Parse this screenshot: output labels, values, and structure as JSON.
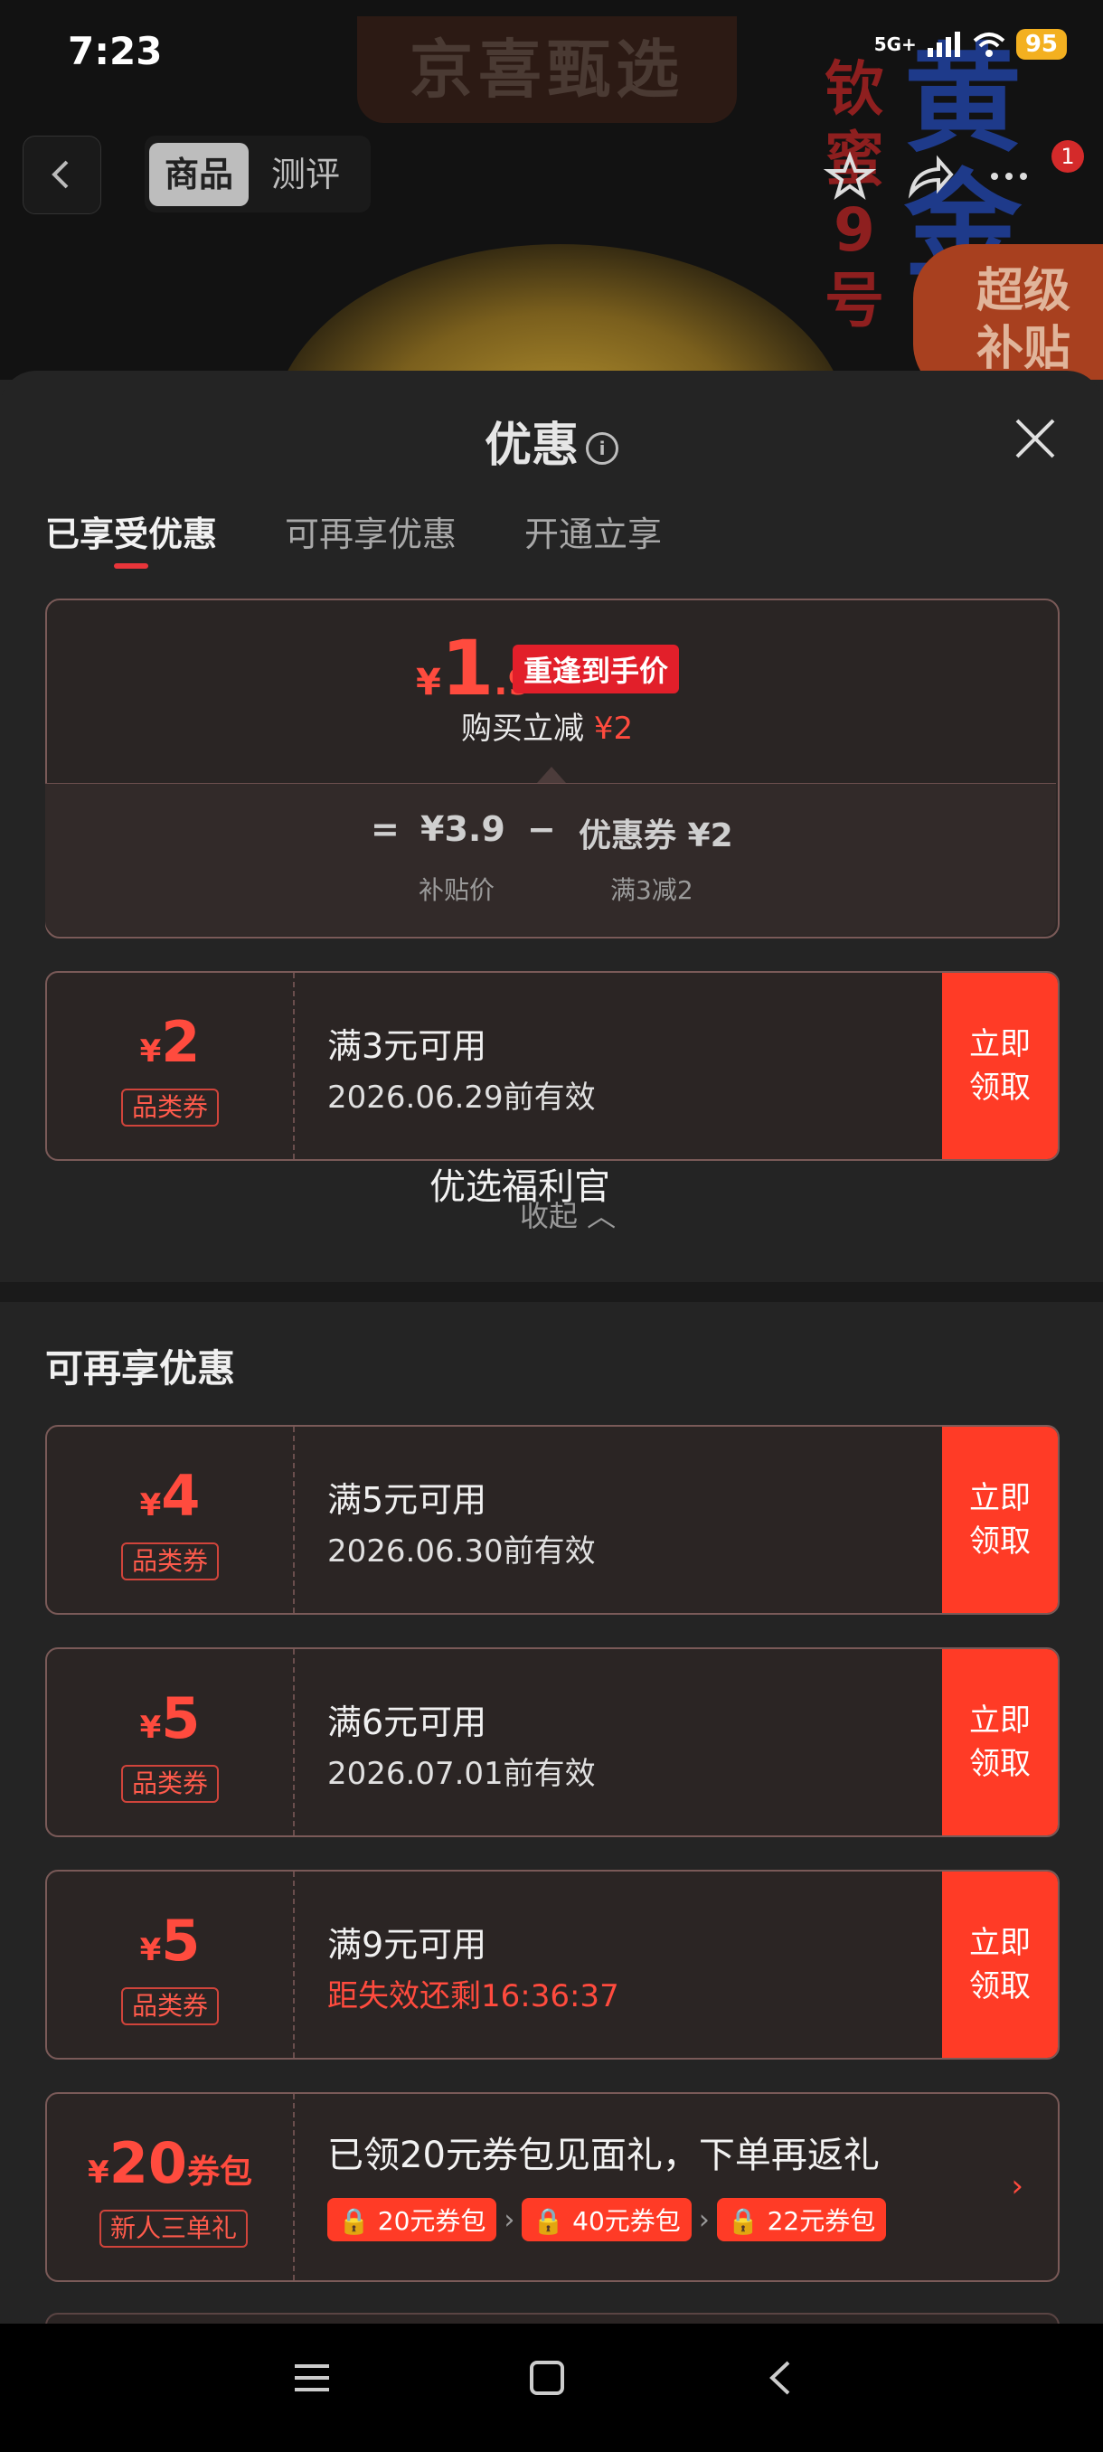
{
  "status_bar": {
    "time": "7:23",
    "network": "5G+",
    "battery": "95"
  },
  "background": {
    "brand": "京喜甄选",
    "red_text": "钦蜜9号",
    "blue_text": "黄金",
    "subsidy_badge": "超级补贴"
  },
  "header": {
    "tab_product": "商品",
    "tab_review": "测评",
    "badge_count": "1"
  },
  "sheet": {
    "title": "优惠",
    "info_glyph": "i",
    "tabs": [
      "已享受优惠",
      "可再享优惠",
      "开通立享"
    ],
    "summary": {
      "currency": "¥",
      "price_big": "1",
      "price_small": ".9",
      "price_tag": "重逢到手价",
      "buy_label": "购买立减",
      "buy_amount": "¥2",
      "eq": "=",
      "subsidy_price": "¥3.9",
      "minus": "−",
      "coupon_text": "优惠券 ¥2",
      "subsidy_label": "补贴价",
      "coupon_label": "满3减2"
    },
    "coupon_enjoyed": {
      "currency": "¥",
      "amount": "2",
      "category": "品类券",
      "condition": "满3元可用",
      "expiry": "2026.06.29前有效",
      "button": "立即\n领取"
    },
    "welfare": "优选福利官",
    "fold": "收起 ︿",
    "more_section_title": "可再享优惠",
    "more_coupons": [
      {
        "currency": "¥",
        "amount": "4",
        "category": "品类券",
        "condition": "满5元可用",
        "expiry": "2026.06.30前有效",
        "button": "立即\n领取"
      },
      {
        "currency": "¥",
        "amount": "5",
        "category": "品类券",
        "condition": "满6元可用",
        "expiry": "2026.07.01前有效",
        "button": "立即\n领取"
      },
      {
        "currency": "¥",
        "amount": "5",
        "category": "品类券",
        "condition": "满9元可用",
        "expiry": "距失效还剩16:36:37",
        "button": "立即\n领取"
      }
    ],
    "pack": {
      "currency": "¥",
      "amount": "20",
      "unit": "券包",
      "category": "新人三单礼",
      "title": "已领20元券包见面礼，下单再返礼",
      "chips": [
        "20元券包",
        "40元券包",
        "22元券包"
      ]
    }
  },
  "colors": {
    "accent": "#ff3b26",
    "price_red": "#ff4b3e",
    "sheet_bg": "#242424"
  }
}
